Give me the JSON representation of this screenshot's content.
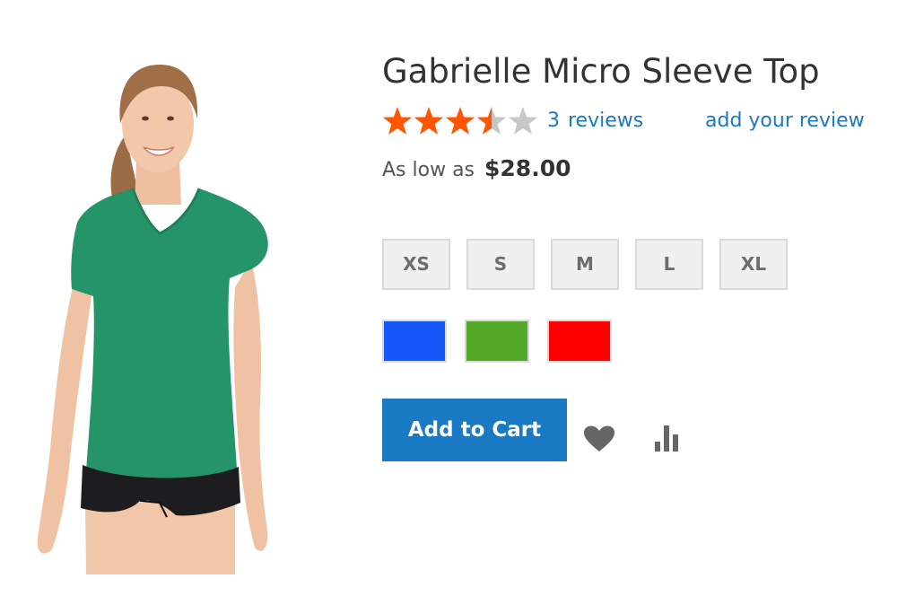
{
  "product": {
    "name": "Gabrielle Micro Sleeve Top",
    "image_alt": "Woman wearing a green v-neck micro sleeve top and black shorts"
  },
  "rating": {
    "value": 3.5,
    "max": 5,
    "colors": {
      "filled": "#ff5501",
      "empty": "#c7c7c7"
    },
    "review_count": "3",
    "reviews_word": "reviews",
    "add_review_label": "add your review"
  },
  "price": {
    "label": "As low as",
    "amount": "$28.00"
  },
  "sizes": [
    "XS",
    "S",
    "M",
    "L",
    "XL"
  ],
  "colors": [
    {
      "name": "Blue",
      "hex": "#1857f7"
    },
    {
      "name": "Green",
      "hex": "#53a828"
    },
    {
      "name": "Red",
      "hex": "#ff0000"
    }
  ],
  "actions": {
    "add_to_cart": "Add to Cart",
    "wishlist_icon": "heart-icon",
    "compare_icon": "bar-chart-icon",
    "primary_color": "#1979c3"
  }
}
